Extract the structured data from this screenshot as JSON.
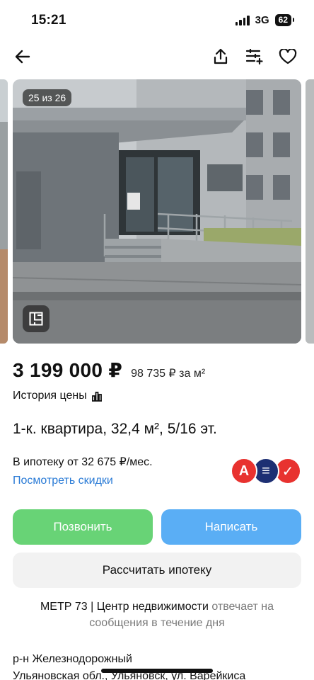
{
  "status_bar": {
    "time": "15:21",
    "network": "3G",
    "battery": "62"
  },
  "nav": {
    "back_icon": "back-arrow-icon",
    "share_icon": "share-icon",
    "compare_icon": "compare-icon",
    "favorite_icon": "heart-icon"
  },
  "gallery": {
    "counter": "25 из 26",
    "plan_icon": "floor-plan-icon"
  },
  "listing": {
    "price": "3 199 000 ₽",
    "price_per_m2": "98 735 ₽ за м²",
    "price_history": "История цены",
    "title": "1-к. квартира, 32,4 м², 5/16 эт."
  },
  "mortgage": {
    "text": "В ипотеку от 32 675 ₽/мес.",
    "discounts_link": "Посмотреть скидки",
    "bank_logos": [
      "А",
      "≡",
      "✓"
    ],
    "bank_colors": [
      "#e8322f",
      "#1d2f73",
      "#e8322f"
    ]
  },
  "actions": {
    "call": "Позвонить",
    "write": "Написать",
    "calc_mortgage": "Рассчитать ипотеку"
  },
  "seller": {
    "name": "МЕТР 73 | Центр недвижимости",
    "response": "отвечает на сообщения в течение дня"
  },
  "location": {
    "district": "р-н Железнодорожный",
    "address": "Ульяновская обл., Ульяновск, ул. Варейкиса"
  },
  "colors": {
    "call_button": "#68d376",
    "write_button": "#5aaef5",
    "link": "#2a7bd6"
  }
}
